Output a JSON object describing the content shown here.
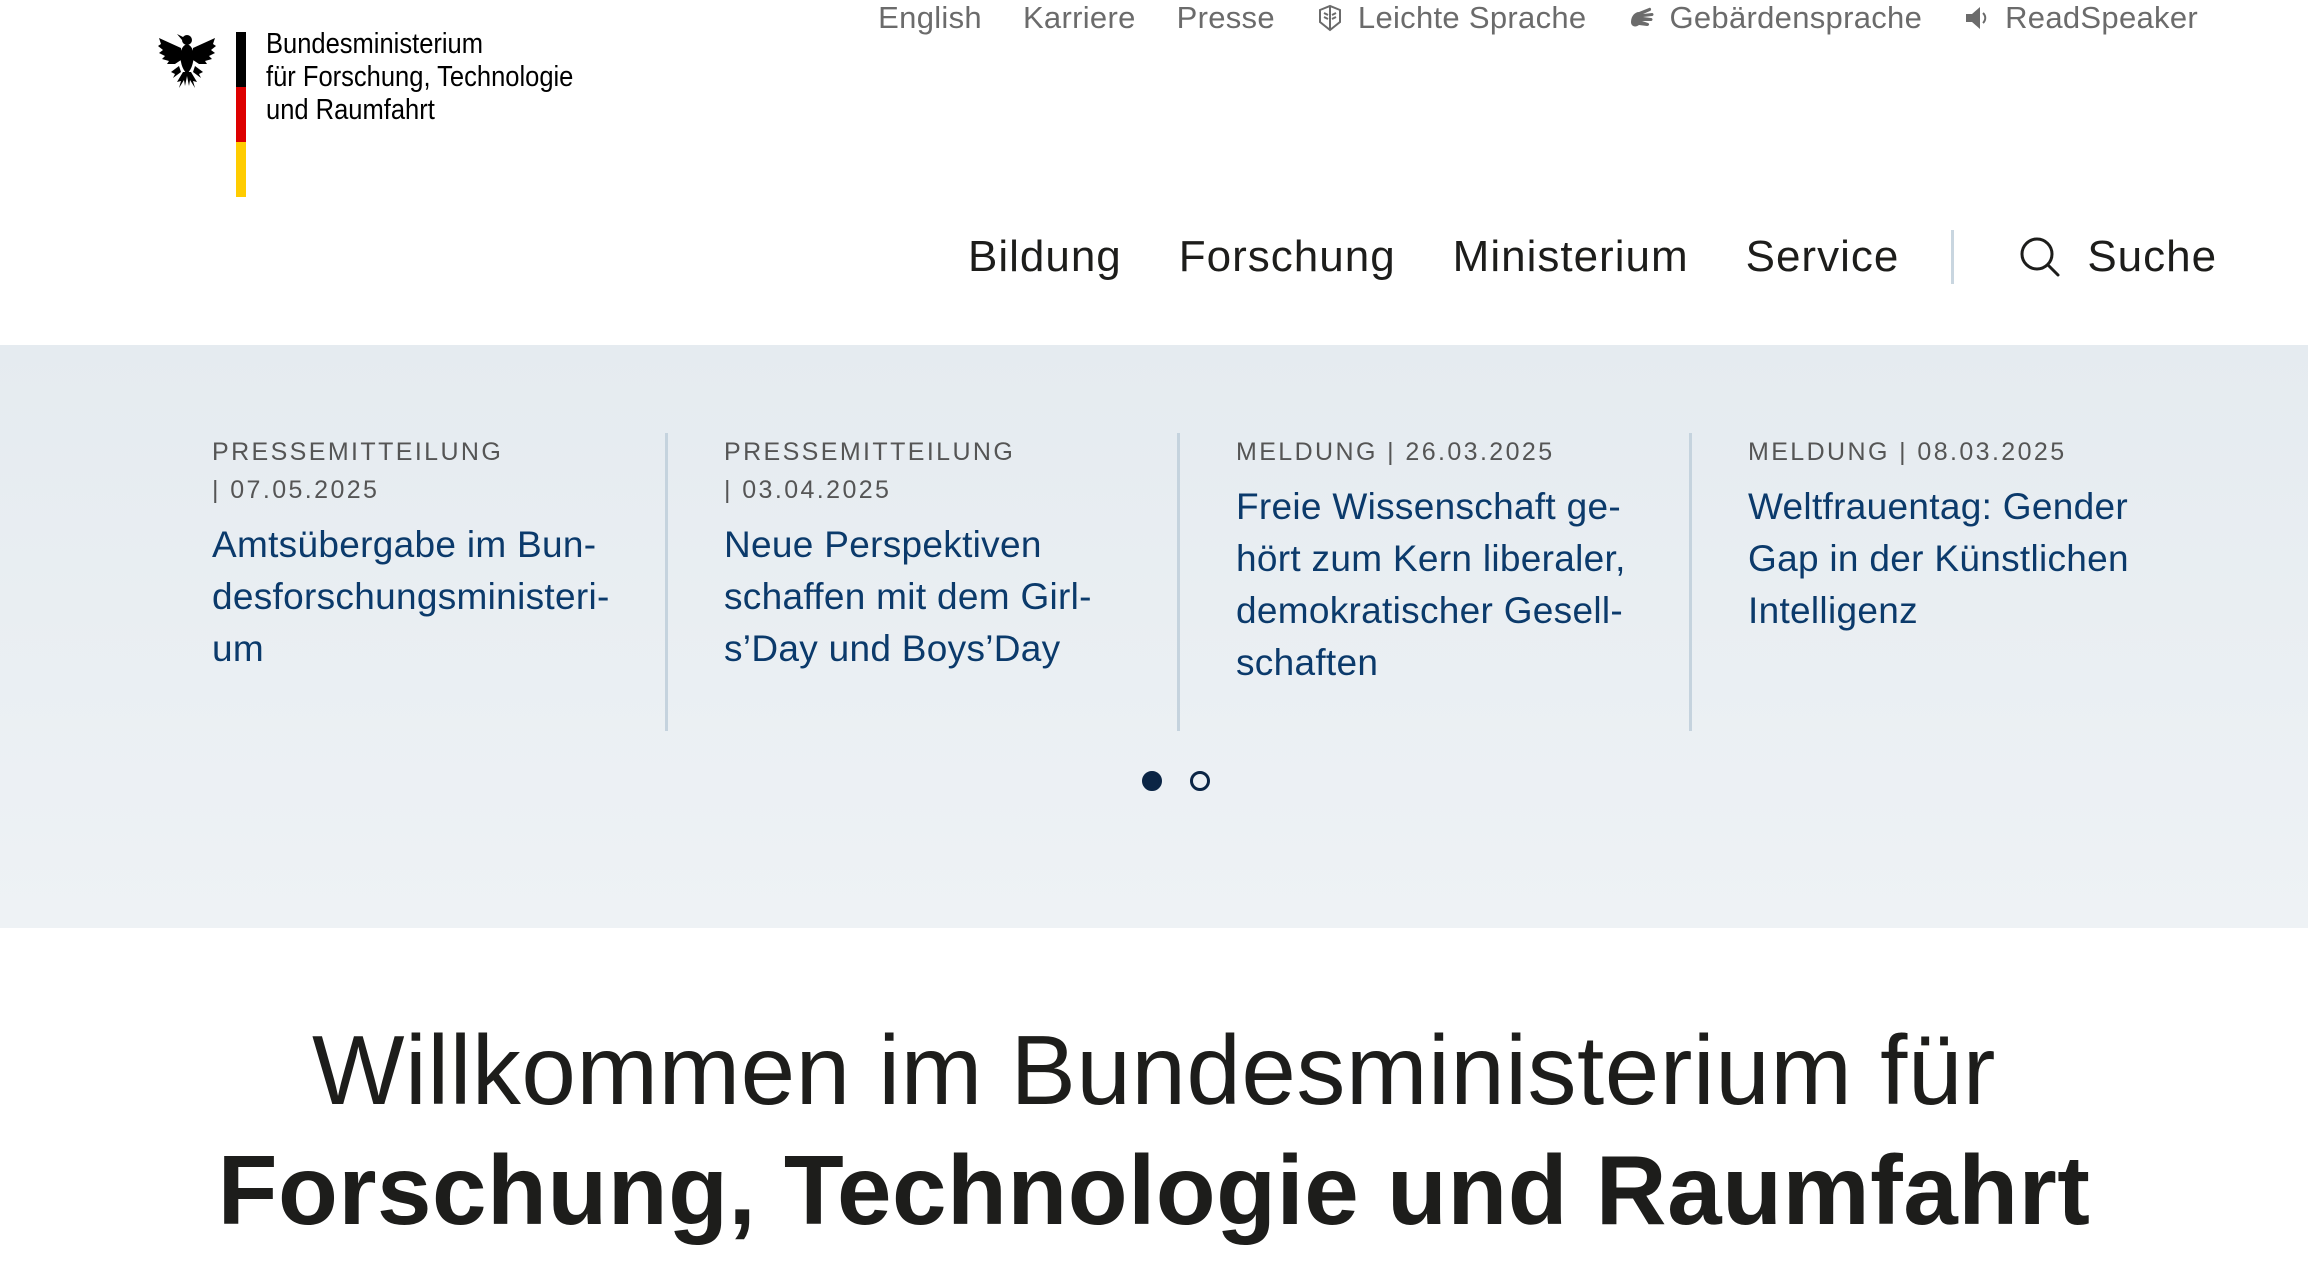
{
  "logo": {
    "line1": "Bundesministerium",
    "line2": "für Forschung, Technologie",
    "line3": "und Raumfahrt"
  },
  "meta_nav": {
    "english": "English",
    "karriere": "Karriere",
    "presse": "Presse",
    "leichte_sprache": "Leichte Sprache",
    "gebaerdensprache": "Gebärdensprache",
    "readspeaker": "ReadSpeaker"
  },
  "main_nav": {
    "items": [
      "Bildung",
      "Forschung",
      "Ministerium",
      "Service"
    ],
    "search_label": "Suche"
  },
  "teasers": [
    {
      "meta_line1": "PRESSEMITTEILUNG",
      "meta_line2": "| 07.05.2025",
      "headline_line1": "Amtsübergabe im Bun-",
      "headline_line2": "desforschungsministeri-",
      "headline_line3": "um",
      "headline_line4": ""
    },
    {
      "meta_line1": "PRESSEMITTEILUNG",
      "meta_line2": "| 03.04.2025",
      "headline_line1": "Neue Perspektiven",
      "headline_line2": "schaffen mit dem Girl-",
      "headline_line3": "s’Day und Boys’Day",
      "headline_line4": ""
    },
    {
      "meta_line1": "MELDUNG | 26.03.2025",
      "meta_line2": "",
      "headline_line1": "Freie Wissenschaft ge-",
      "headline_line2": "hört zum Kern liberaler,",
      "headline_line3": "demokratischer Gesell-",
      "headline_line4": "schaften"
    },
    {
      "meta_line1": "MELDUNG | 08.03.2025",
      "meta_line2": "",
      "headline_line1": "Weltfrauentag: Gender",
      "headline_line2": "Gap in der Künstlichen",
      "headline_line3": "Intelligenz",
      "headline_line4": ""
    }
  ],
  "slider": {
    "page_count": 2,
    "active_page": 1
  },
  "welcome": {
    "line1": "Willkommen im Bundesministerium für",
    "line2": "Forschung, Technologie und Raumfahrt"
  },
  "colors": {
    "headline_blue": "#0b3a6b",
    "meta_gray": "#555555",
    "band_background": "#e5ebf0",
    "divider": "#c5d3de",
    "flag_black": "#000000",
    "flag_red": "#dd0000",
    "flag_gold": "#ffcc00"
  },
  "icons": {
    "logo": "federal-eagle-icon",
    "leichte_sprache": "easy-language-icon",
    "gebaerdensprache": "sign-language-icon",
    "readspeaker": "speaker-icon",
    "search": "search-icon"
  }
}
